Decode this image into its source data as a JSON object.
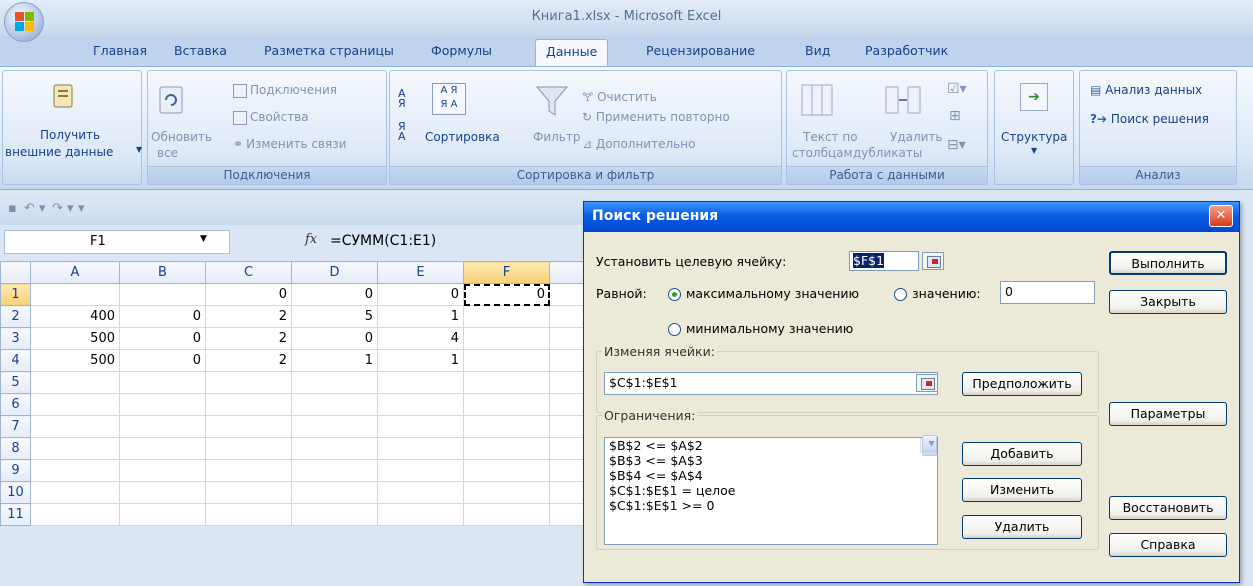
{
  "window": {
    "title": "Книга1.xlsx - Microsoft Excel"
  },
  "tabs": [
    "Главная",
    "Вставка",
    "Разметка страницы",
    "Формулы",
    "Данные",
    "Рецензирование",
    "Вид",
    "Разработчик"
  ],
  "active_tab": "Данные",
  "ribbon": {
    "get_external": {
      "line1": "Получить",
      "line2": "внешние данные"
    },
    "connections": {
      "refresh_line1": "Обновить",
      "refresh_line2": "все",
      "connections": "Подключения",
      "properties": "Свойства",
      "edit_links": "Изменить связи",
      "label": "Подключения"
    },
    "sort_filter": {
      "sort": "Сортировка",
      "filter": "Фильтр",
      "clear": "Очистить",
      "reapply": "Применить повторно",
      "advanced": "Дополнительно",
      "label": "Сортировка и фильтр"
    },
    "data_tools": {
      "text_cols_line1": "Текст по",
      "text_cols_line2": "столбцам",
      "remove_dup_line1": "Удалить",
      "remove_dup_line2": "дубликаты",
      "label": "Работа с данными"
    },
    "outline": {
      "label": "Структура"
    },
    "analysis": {
      "data_analysis": "Анализ данных",
      "solver": "Поиск решения",
      "label": "Анализ"
    }
  },
  "formula_bar": {
    "name_box": "F1",
    "fx": "fx",
    "formula": "=СУММ(C1:E1)"
  },
  "sheet": {
    "columns": [
      "A",
      "B",
      "C",
      "D",
      "E",
      "F"
    ],
    "rows": [
      {
        "num": "1",
        "cells": [
          "",
          "",
          "0",
          "0",
          "0",
          "0"
        ]
      },
      {
        "num": "2",
        "cells": [
          "400",
          "0",
          "2",
          "5",
          "1",
          ""
        ]
      },
      {
        "num": "3",
        "cells": [
          "500",
          "0",
          "2",
          "0",
          "4",
          ""
        ]
      },
      {
        "num": "4",
        "cells": [
          "500",
          "0",
          "2",
          "1",
          "1",
          ""
        ]
      },
      {
        "num": "5",
        "cells": [
          "",
          "",
          "",
          "",
          "",
          ""
        ]
      },
      {
        "num": "6",
        "cells": [
          "",
          "",
          "",
          "",
          "",
          ""
        ]
      },
      {
        "num": "7",
        "cells": [
          "",
          "",
          "",
          "",
          "",
          ""
        ]
      },
      {
        "num": "8",
        "cells": [
          "",
          "",
          "",
          "",
          "",
          ""
        ]
      },
      {
        "num": "9",
        "cells": [
          "",
          "",
          "",
          "",
          "",
          ""
        ]
      },
      {
        "num": "10",
        "cells": [
          "",
          "",
          "",
          "",
          "",
          ""
        ]
      },
      {
        "num": "11",
        "cells": [
          "",
          "",
          "",
          "",
          "",
          ""
        ]
      }
    ]
  },
  "dialog": {
    "title": "Поиск решения",
    "target_label": "Установить целевую ячейку:",
    "target_value": "$F$1",
    "equal_label": "Равной:",
    "opt_max": "максимальному значению",
    "opt_value": "значению:",
    "value_input": "0",
    "opt_min": "минимальному значению",
    "changing_label": "Изменяя ячейки:",
    "changing_value": "$C$1:$E$1",
    "guess": "Предположить",
    "constraints_label": "Ограничения:",
    "constraints": [
      "$B$2 <= $A$2",
      "$B$3 <= $A$3",
      "$B$4 <= $A$4",
      "$C$1:$E$1 = целое",
      "$C$1:$E$1 >= 0"
    ],
    "add": "Добавить",
    "change": "Изменить",
    "delete": "Удалить",
    "solve": "Выполнить",
    "close": "Закрыть",
    "options": "Параметры",
    "reset": "Восстановить",
    "help": "Справка"
  }
}
